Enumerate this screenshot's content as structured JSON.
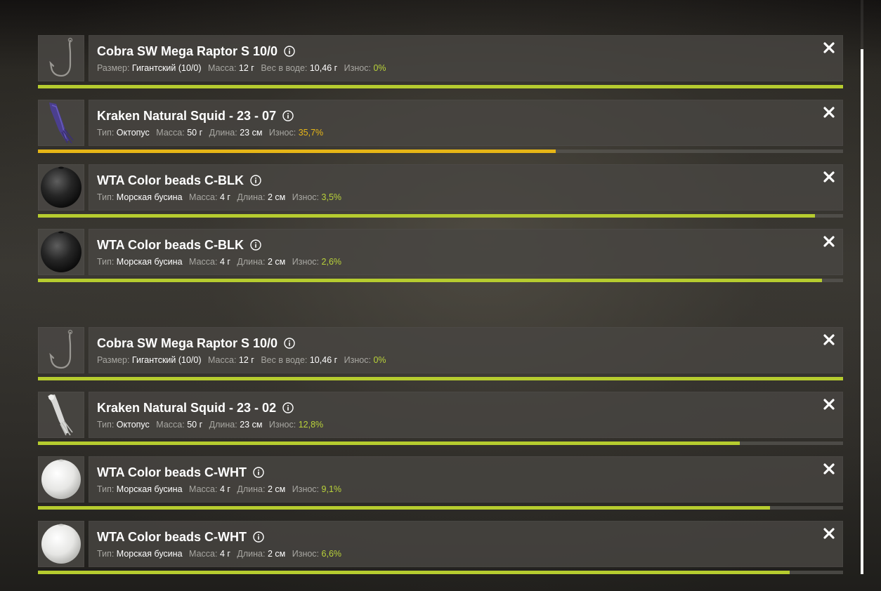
{
  "labels": {
    "size": "Размер:",
    "type": "Тип:",
    "mass": "Масса:",
    "length": "Длина:",
    "water_weight": "Вес в воде:",
    "wear": "Износ:"
  },
  "colors": {
    "wear_ok": "#b6cc2f",
    "wear_warn": "#e6b516",
    "panel_bg": "#48463f"
  },
  "icons": {
    "info": "info-icon",
    "close": "close-icon"
  },
  "items": [
    {
      "name": "Cobra SW Mega Raptor S 10/0",
      "image": "hook-icon",
      "size": "Гигантский (10/0)",
      "mass": "12 г",
      "water_weight": "10,46 г",
      "wear_text": "0%",
      "condition": 1.0,
      "warn": false
    },
    {
      "name": "Kraken Natural Squid - 23 - 07",
      "image": "purple-squid-lure-icon",
      "type": "Октопус",
      "mass": "50 г",
      "length": "23 см",
      "wear_text": "35,7%",
      "condition": 0.643,
      "warn": true
    },
    {
      "name": "WTA Color beads C-BLK",
      "image": "black-bead-icon",
      "type": "Морская бусина",
      "mass": "4 г",
      "length": "2 см",
      "wear_text": "3,5%",
      "condition": 0.965,
      "warn": false
    },
    {
      "name": "WTA Color beads C-BLK",
      "image": "black-bead-icon",
      "type": "Морская бусина",
      "mass": "4 г",
      "length": "2 см",
      "wear_text": "2,6%",
      "condition": 0.974,
      "warn": false
    },
    {
      "name": "Cobra SW Mega Raptor S 10/0",
      "image": "hook-icon",
      "size": "Гигантский (10/0)",
      "mass": "12 г",
      "water_weight": "10,46 г",
      "wear_text": "0%",
      "condition": 1.0,
      "warn": false
    },
    {
      "name": "Kraken Natural Squid - 23 - 02",
      "image": "white-squid-lure-icon",
      "type": "Октопус",
      "mass": "50 г",
      "length": "23 см",
      "wear_text": "12,8%",
      "condition": 0.872,
      "warn": false
    },
    {
      "name": "WTA Color beads C-WHT",
      "image": "white-bead-icon",
      "type": "Морская бусина",
      "mass": "4 г",
      "length": "2 см",
      "wear_text": "9,1%",
      "condition": 0.909,
      "warn": false
    },
    {
      "name": "WTA Color beads C-WHT",
      "image": "white-bead-icon",
      "type": "Морская бусина",
      "mass": "4 г",
      "length": "2 см",
      "wear_text": "6,6%",
      "condition": 0.934,
      "warn": false
    }
  ]
}
